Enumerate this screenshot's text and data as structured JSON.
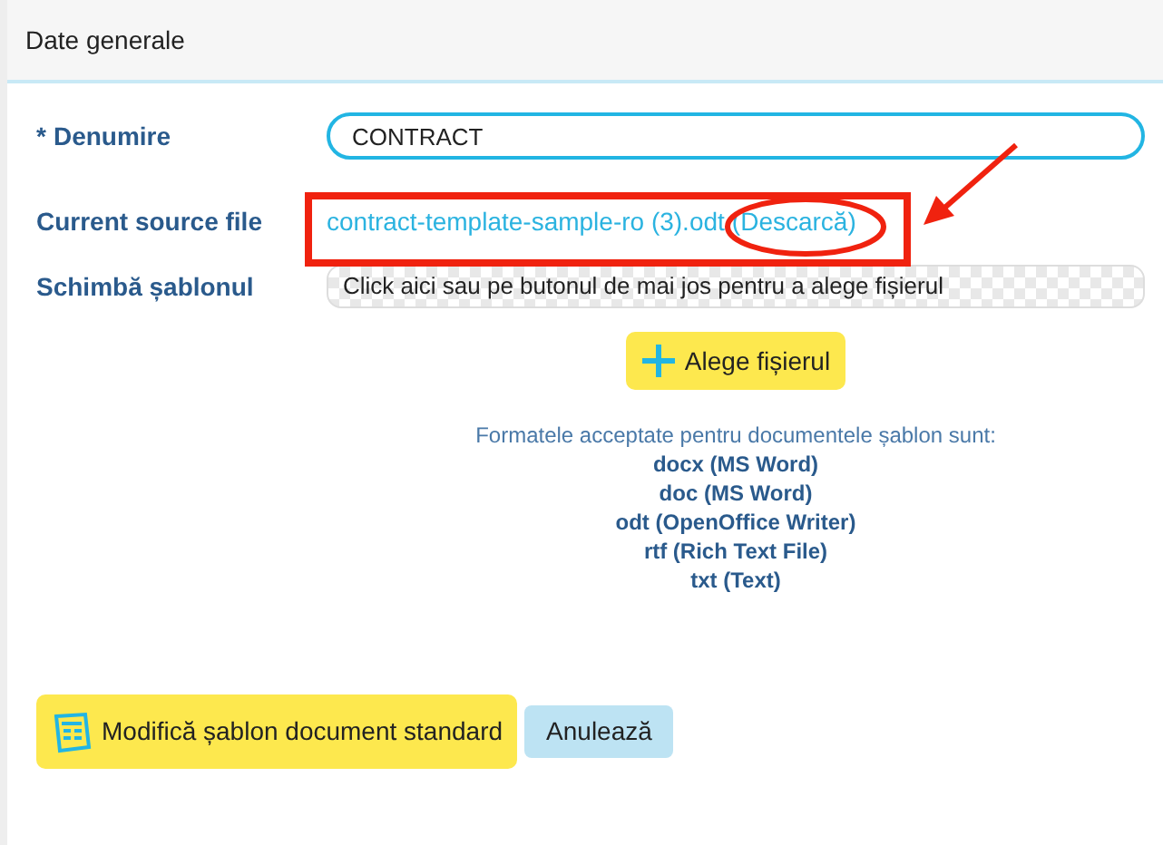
{
  "section_title": "Date generale",
  "fields": [
    {
      "kind": "text",
      "label": "Denumire",
      "required": true,
      "required_mark": "*",
      "value": "CONTRACT"
    },
    {
      "kind": "link",
      "label": "Current source file",
      "required": false,
      "file_name": "contract-template-sample-ro (3).odt",
      "download_link": "(Descarcă)"
    },
    {
      "kind": "file",
      "label": "Schimbă șablonul",
      "required": false,
      "placeholder": "Click aici sau pe butonul de mai jos pentru a alege fișierul"
    }
  ],
  "choose_button": "Alege fișierul",
  "formats_intro": "Formatele acceptate pentru documentele șablon sunt:",
  "formats": [
    "docx (MS Word)",
    "doc (MS Word)",
    "odt (OpenOffice Writer)",
    "rtf (Rich Text File)",
    "txt (Text)"
  ],
  "submit_button": "Modifică șablon document standard",
  "cancel_button": "Anulează"
}
